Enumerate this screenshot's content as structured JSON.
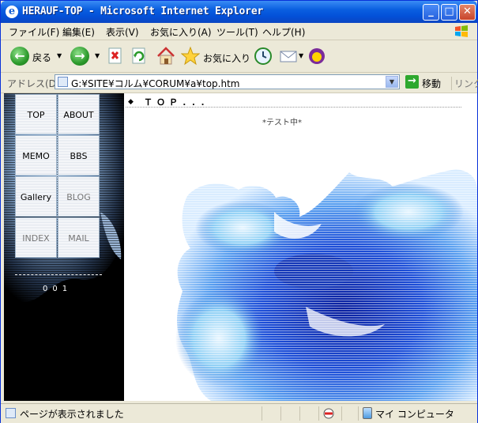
{
  "window": {
    "title": "HERAUF-TOP - Microsoft Internet Explorer",
    "buttons": {
      "minimize": "_",
      "maximize": "□",
      "close": "✕"
    }
  },
  "menu": {
    "items": [
      "ファイル(F)",
      "編集(E)",
      "表示(V)",
      "お気に入り(A)",
      "ツール(T)",
      "ヘルプ(H)"
    ]
  },
  "toolbar": {
    "back_label": "戻る",
    "favorites_label": "お気に入り"
  },
  "address": {
    "label": "アドレス(D)",
    "url": "G:¥SITE¥コルム¥CORUM¥a¥top.htm",
    "go_label": "移動",
    "links_label": "リンク"
  },
  "page": {
    "nav": [
      {
        "label": "TOP",
        "dim": false
      },
      {
        "label": "ABOUT",
        "dim": false
      },
      {
        "label": "MEMO",
        "dim": false
      },
      {
        "label": "BBS",
        "dim": false
      },
      {
        "label": "Gallery",
        "dim": false
      },
      {
        "label": "BLOG",
        "dim": true
      },
      {
        "label": "INDEX",
        "dim": true
      },
      {
        "label": "MAIL",
        "dim": true
      }
    ],
    "counter": "001",
    "header": "ＴＯＰ...",
    "subtitle": "*テスト中*"
  },
  "status": {
    "message": "ページが表示されました",
    "zone": "マイ コンピュータ"
  },
  "colors": {
    "titlebar": "#0a5fe0",
    "chrome": "#ece9d8",
    "art_blue": "#1e3fc8"
  }
}
